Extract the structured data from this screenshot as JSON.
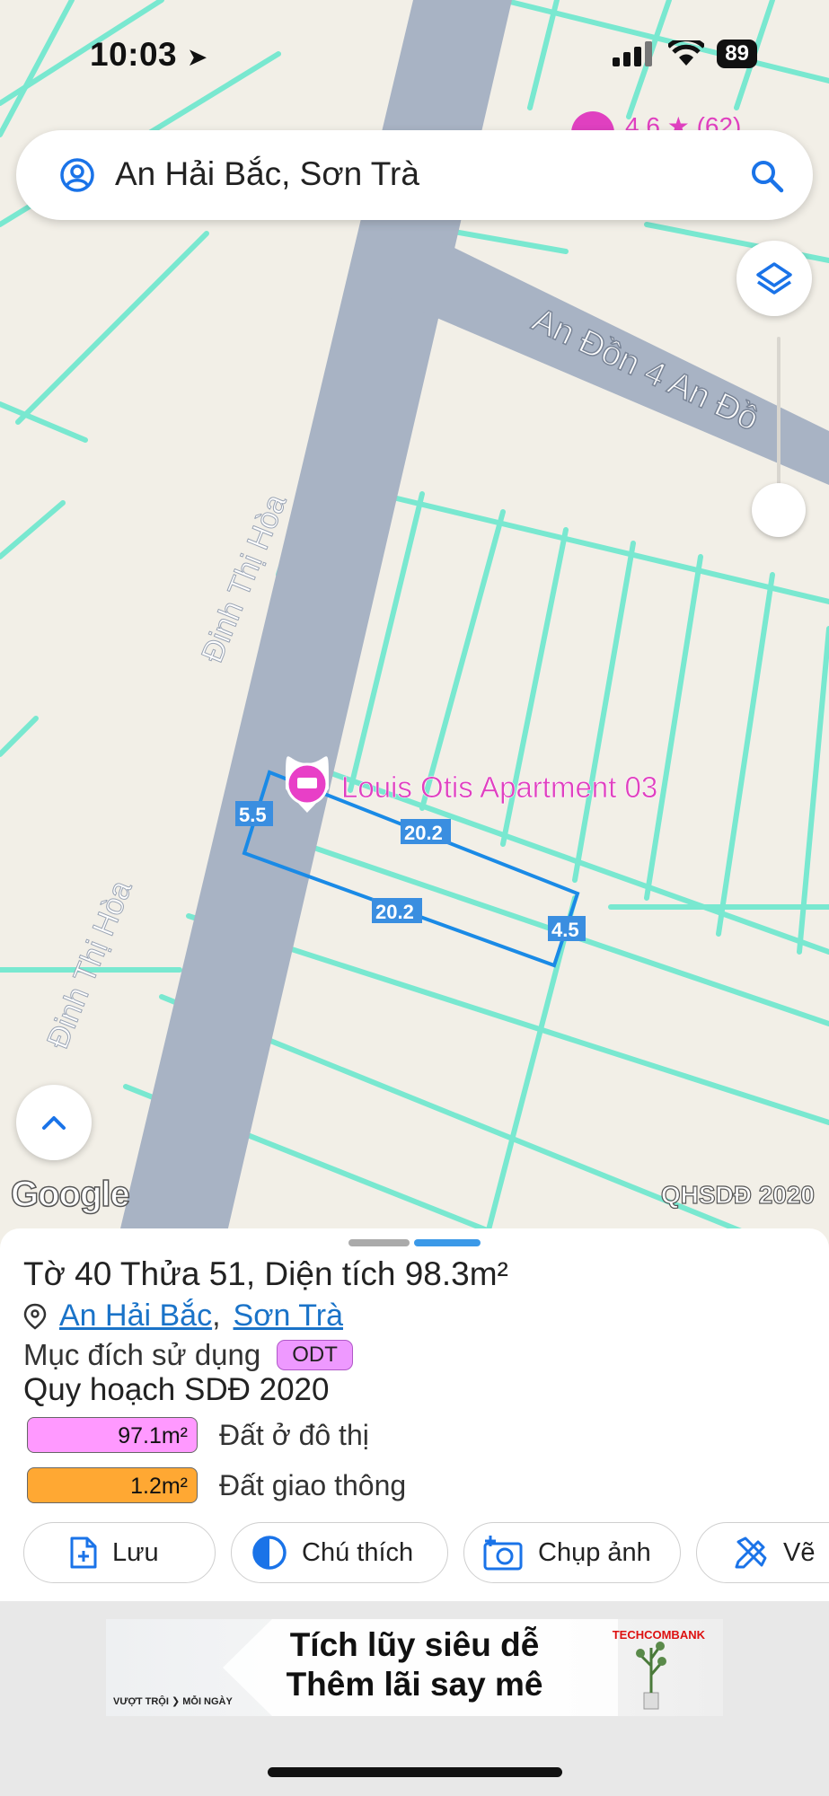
{
  "status": {
    "time": "10:03",
    "battery": "89"
  },
  "search": {
    "query": "An Hải Bắc, Sơn Trà",
    "icon": "search-icon"
  },
  "map": {
    "top_rating": "4.6 ★ (62)",
    "roads": [
      "Đinh Thị Hòa",
      "Đinh Thị Hòa",
      "An Đồn 4 An Đồ"
    ],
    "poi": "Louis Otis Apartment 03",
    "dimensions": [
      "5.5",
      "20.2",
      "20.2",
      "4.5"
    ],
    "google_logo": "Google",
    "layer_label": "QHSDĐ 2020",
    "colors": {
      "background": "#f2efe7",
      "road": "#a8b3c4",
      "parcel_line": "#79e8d0",
      "selection": "#1a8ae6",
      "poi": "#e040c0"
    }
  },
  "info": {
    "title": "Tờ 40 Thửa 51, Diện tích 98.3m²",
    "ward": "An Hải Bắc",
    "comma": ",",
    "district": "Sơn Trà",
    "purpose_label": "Mục đích sử dụng",
    "purpose_code": "ODT",
    "plan_label": "Quy hoạch SDĐ 2020",
    "zones": [
      {
        "area": "97.1m²",
        "label": "Đất ở đô thị",
        "color": "#ff99ff"
      },
      {
        "area": "1.2m²",
        "label": "Đất giao thông",
        "color": "#ffa833"
      }
    ]
  },
  "actions": [
    {
      "label": "Lưu",
      "icon": "add-file-icon"
    },
    {
      "label": "Chú thích",
      "icon": "half-circle-icon"
    },
    {
      "label": "Chụp ảnh",
      "icon": "camera-plus-icon"
    },
    {
      "label": "Vẽ",
      "icon": "draw-tools-icon"
    }
  ],
  "ad": {
    "line1": "Tích lũy siêu dễ",
    "line2": "Thêm lãi say mê",
    "brand": "TECHCOMBANK",
    "slogan": "VƯỢT TRỘI ❯ MỖI NGÀY"
  }
}
